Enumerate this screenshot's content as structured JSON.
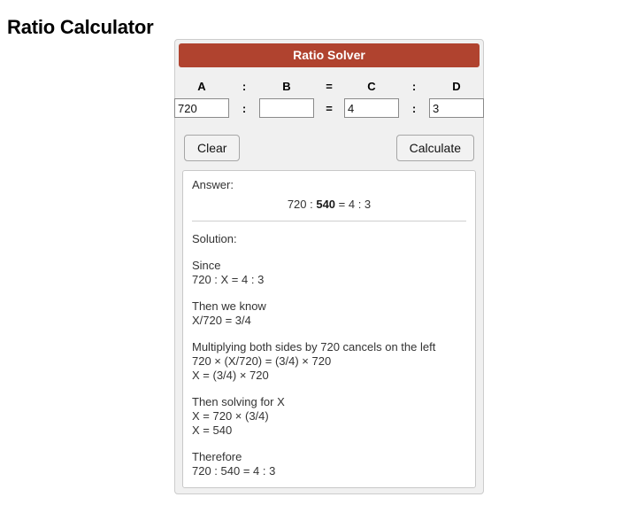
{
  "page": {
    "title": "Ratio Calculator"
  },
  "panel": {
    "header": "Ratio Solver",
    "labels": {
      "a": "A",
      "colon1": ":",
      "b": "B",
      "equals": "=",
      "c": "C",
      "colon2": ":",
      "d": "D"
    },
    "separators": {
      "colon1": ":",
      "equals": "=",
      "colon2": ":"
    },
    "inputs": {
      "a_value": "720",
      "b_value": "",
      "c_value": "4",
      "d_value": "3",
      "a_placeholder": "",
      "b_placeholder": "",
      "c_placeholder": "",
      "d_placeholder": ""
    },
    "buttons": {
      "clear": "Clear",
      "calculate": "Calculate"
    },
    "colors": {
      "header_bg": "#b0432f",
      "header_text": "#ffffff",
      "panel_bg": "#f0f0f0",
      "answer_bg": "#ffffff"
    }
  },
  "result": {
    "answer_label": "Answer:",
    "answer_prefix": "720 : ",
    "answer_highlight": "540",
    "answer_suffix": " = 4 : 3",
    "solution_label": "Solution:",
    "blocks": [
      {
        "lines": [
          "Since",
          "720 : X = 4 : 3"
        ]
      },
      {
        "lines": [
          "Then we know",
          "X/720 = 3/4"
        ]
      },
      {
        "lines": [
          "Multiplying both sides by 720 cancels on the left",
          "720 × (X/720) = (3/4) × 720",
          "X = (3/4) × 720"
        ]
      },
      {
        "lines": [
          "Then solving for X",
          "X = 720 × (3/4)",
          "X = 540"
        ]
      },
      {
        "lines": [
          "Therefore",
          "720 : 540 = 4 : 3"
        ]
      }
    ]
  }
}
